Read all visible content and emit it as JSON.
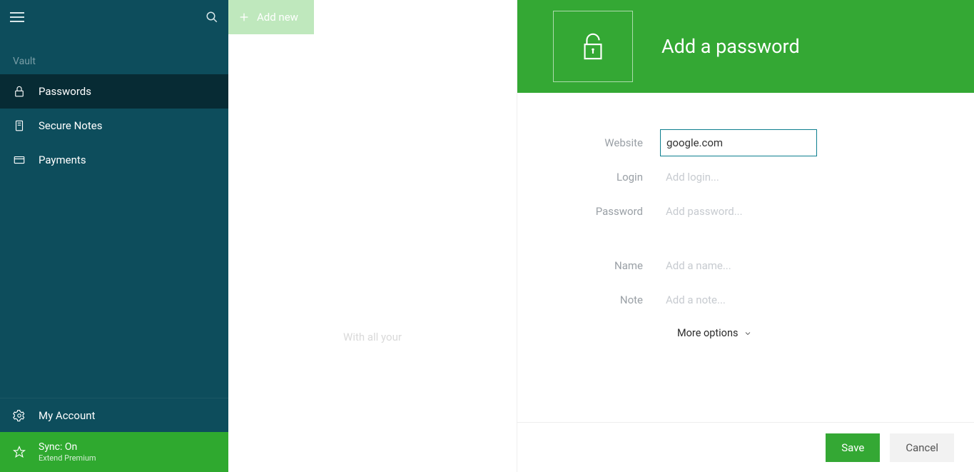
{
  "sidebar": {
    "section_label": "Vault",
    "items": [
      {
        "label": "Passwords",
        "icon": "lock-icon",
        "active": true
      },
      {
        "label": "Secure Notes",
        "icon": "note-icon",
        "active": false
      },
      {
        "label": "Payments",
        "icon": "card-icon",
        "active": false
      }
    ],
    "account_label": "My Account",
    "sync": {
      "title": "Sync: On",
      "subtitle": "Extend Premium"
    }
  },
  "middle": {
    "add_new_label": "Add new",
    "hint": "With all your"
  },
  "detail": {
    "header_title": "Add a password",
    "fields": {
      "website": {
        "label": "Website",
        "value": "google.com",
        "placeholder": ""
      },
      "login": {
        "label": "Login",
        "value": "",
        "placeholder": "Add login..."
      },
      "password": {
        "label": "Password",
        "value": "",
        "placeholder": "Add password..."
      },
      "name": {
        "label": "Name",
        "value": "",
        "placeholder": "Add a name..."
      },
      "note": {
        "label": "Note",
        "value": "",
        "placeholder": "Add a note..."
      }
    },
    "more_options_label": "More options",
    "buttons": {
      "save": "Save",
      "cancel": "Cancel"
    }
  },
  "colors": {
    "accent_green": "#34a834",
    "sidebar_teal": "#0d4d5c",
    "active_nav": "#072b34"
  }
}
